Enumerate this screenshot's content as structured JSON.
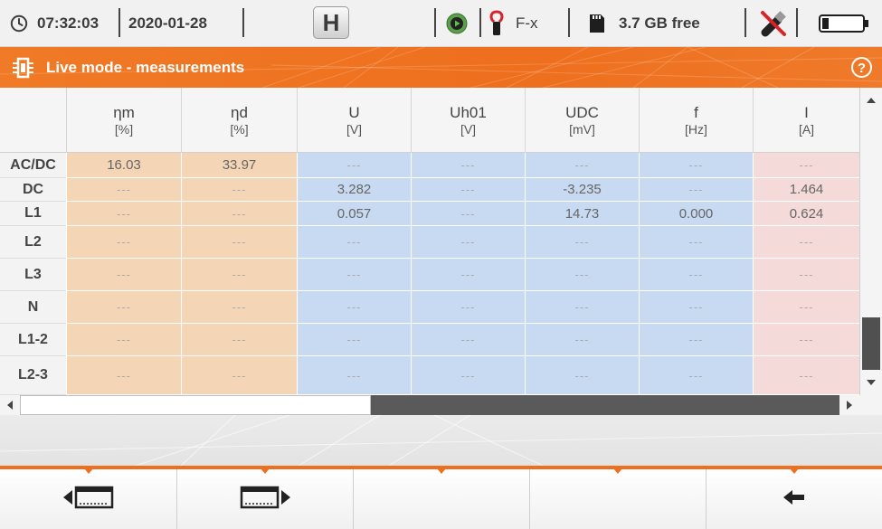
{
  "status_bar": {
    "clock_icon": "clock-icon",
    "time": "07:32:03",
    "date": "2020-01-28",
    "hold_button": "H",
    "record_icon": "play-circle-icon",
    "clamp_icon": "current-clamp-icon",
    "clamp_type": "F-x",
    "sd_card_icon": "sd-card-icon",
    "storage_free": "3.7 GB free",
    "usb_icon": "usb-disconnected-icon",
    "battery_icon": "battery-low-icon"
  },
  "title_bar": {
    "mode_icon": "live-mode-icon",
    "title": "Live mode - measurements",
    "help_icon": "help-icon"
  },
  "table": {
    "columns": [
      {
        "symbol": "ηm",
        "unit": "[%]"
      },
      {
        "symbol": "ηd",
        "unit": "[%]"
      },
      {
        "symbol": "U",
        "unit": "[V]"
      },
      {
        "symbol": "Uh01",
        "unit": "[V]"
      },
      {
        "symbol": "UDC",
        "unit": "[mV]"
      },
      {
        "symbol": "f",
        "unit": "[Hz]"
      },
      {
        "symbol": "I",
        "unit": "[A]"
      }
    ],
    "rows": [
      {
        "label": "AC/DC",
        "cells": [
          "16.03",
          "33.97",
          "---",
          "---",
          "---",
          "---",
          "---"
        ]
      },
      {
        "label": "DC",
        "cells": [
          "---",
          "---",
          "3.282",
          "---",
          "-3.235",
          "---",
          "1.464"
        ]
      },
      {
        "label": "L1",
        "cells": [
          "---",
          "---",
          "0.057",
          "---",
          "14.73",
          "0.000",
          "0.624"
        ]
      },
      {
        "label": "L2",
        "cells": [
          "---",
          "---",
          "---",
          "---",
          "---",
          "---",
          "---"
        ]
      },
      {
        "label": "L3",
        "cells": [
          "---",
          "---",
          "---",
          "---",
          "---",
          "---",
          "---"
        ]
      },
      {
        "label": "N",
        "cells": [
          "---",
          "---",
          "---",
          "---",
          "---",
          "---",
          "---"
        ]
      },
      {
        "label": "L1-2",
        "cells": [
          "---",
          "---",
          "---",
          "---",
          "---",
          "---",
          "---"
        ]
      },
      {
        "label": "L2-3",
        "cells": [
          "---",
          "---",
          "---",
          "---",
          "---",
          "---",
          "---"
        ]
      }
    ],
    "column_colors": [
      "#f4d5b6",
      "#f4d5b6",
      "#c8daf1",
      "#c8daf1",
      "#c8daf1",
      "#c8daf1",
      "#f5dada"
    ]
  },
  "scrollbars": {
    "up_icon": "scroll-up-arrow-icon",
    "down_icon": "scroll-down-arrow-icon",
    "left_icon": "scroll-left-arrow-icon",
    "right_icon": "scroll-right-arrow-icon"
  },
  "bottom_bar": {
    "buttons": [
      {
        "icon": "scroll-columns-left-icon"
      },
      {
        "icon": "scroll-columns-right-icon"
      },
      {
        "icon": ""
      },
      {
        "icon": ""
      },
      {
        "icon": "back-arrow-icon"
      }
    ]
  },
  "colors": {
    "accent": "#ee6f1e",
    "status_bar_bg": "#f1f1f1",
    "header_bg": "#f5f5f5",
    "row_label_bg": "#f3f3f3"
  }
}
